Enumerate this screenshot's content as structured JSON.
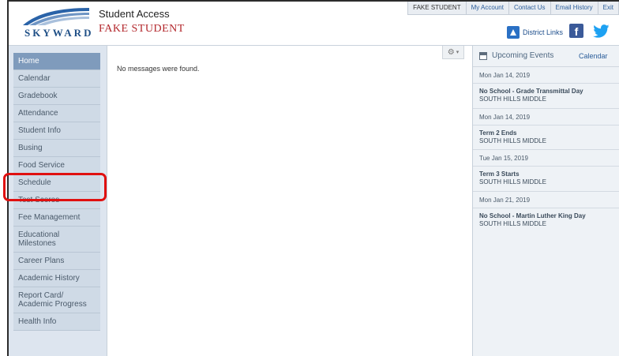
{
  "header": {
    "logo_text": "SKYWARD",
    "app_title": "Student Access",
    "student_name": "FAKE STUDENT",
    "top_links": [
      "FAKE STUDENT",
      "My Account",
      "Contact Us",
      "Email History",
      "Exit"
    ],
    "district_links": "District Links"
  },
  "sidebar": {
    "items": [
      {
        "label": "Home"
      },
      {
        "label": "Calendar"
      },
      {
        "label": "Gradebook"
      },
      {
        "label": "Attendance"
      },
      {
        "label": "Student Info"
      },
      {
        "label": "Busing"
      },
      {
        "label": "Food Service"
      },
      {
        "label": "Schedule"
      },
      {
        "label": "Test Scores"
      },
      {
        "label": "Fee Management"
      },
      {
        "label": "Educational Milestones"
      },
      {
        "label": "Career Plans"
      },
      {
        "label": "Academic History"
      },
      {
        "label": "Report Card/ Academic Progress"
      },
      {
        "label": "Health Info"
      }
    ]
  },
  "main": {
    "message": "No messages were found."
  },
  "events": {
    "title": "Upcoming Events",
    "link": "Calendar",
    "items": [
      {
        "date": "Mon Jan 14, 2019",
        "title": "No School - Grade Transmittal Day",
        "location": "SOUTH HILLS MIDDLE"
      },
      {
        "date": "Mon Jan 14, 2019",
        "title": "Term 2 Ends",
        "location": "SOUTH HILLS MIDDLE"
      },
      {
        "date": "Tue Jan 15, 2019",
        "title": "Term 3 Starts",
        "location": "SOUTH HILLS MIDDLE"
      },
      {
        "date": "Mon Jan 21, 2019",
        "title": "No School - Martin Luther King Day",
        "location": "SOUTH HILLS MIDDLE"
      }
    ]
  },
  "colors": {
    "accent": "#7f9bbc",
    "highlight": "#e01010",
    "brand_red": "#b3282d"
  }
}
